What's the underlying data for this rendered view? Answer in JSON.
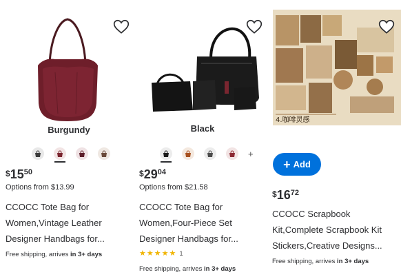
{
  "products": [
    {
      "variant_label": "Burgundy",
      "swatch_colors": [
        "#3a3a3a",
        "#7a2630",
        "#5c1e2a",
        "#6b4a3a"
      ],
      "price": {
        "dollar": "$",
        "whole": "15",
        "cents": "50"
      },
      "options_text": "Options from $13.99",
      "title_lines": [
        "CCOCC Tote Bag for",
        "Women,Vintage Leather",
        "Designer Handbags for..."
      ],
      "shipping_prefix": "Free shipping, arrives ",
      "shipping_bold": "in 3+ days",
      "image_icon": "burgundy-tote-bag-image"
    },
    {
      "variant_label": "Black",
      "swatch_colors": [
        "#1b1b1b",
        "#a8501f",
        "#4c4c4c",
        "#8c2a34"
      ],
      "more_symbol": "+",
      "price": {
        "dollar": "$",
        "whole": "29",
        "cents": "04"
      },
      "options_text": "Options from $21.58",
      "title_lines": [
        "CCOCC Tote Bag for",
        "Women,Four-Piece Set",
        "Designer Handbags for..."
      ],
      "rating": 5,
      "review_count": "1",
      "shipping_prefix": "Free shipping, arrives ",
      "shipping_bold": "in 3+ days",
      "image_icon": "black-four-piece-bag-set-image"
    },
    {
      "add_label": "Add",
      "price": {
        "dollar": "$",
        "whole": "16",
        "cents": "72"
      },
      "title_lines": [
        "CCOCC Scrapbook",
        "Kit,Complete Scrapbook Kit",
        "Stickers,Creative Designs..."
      ],
      "shipping_prefix": "Free shipping, arrives ",
      "shipping_bold": "in 3+ days",
      "image_caption": "4.咖啡灵感",
      "image_icon": "scrapbook-kit-image"
    }
  ],
  "colors": {
    "accent": "#0071dc",
    "text": "#2e2f32",
    "star": "#f0b400"
  },
  "icons": {
    "favorite": "heart-outline-icon",
    "add": "plus-icon",
    "rating": "star-icon"
  }
}
